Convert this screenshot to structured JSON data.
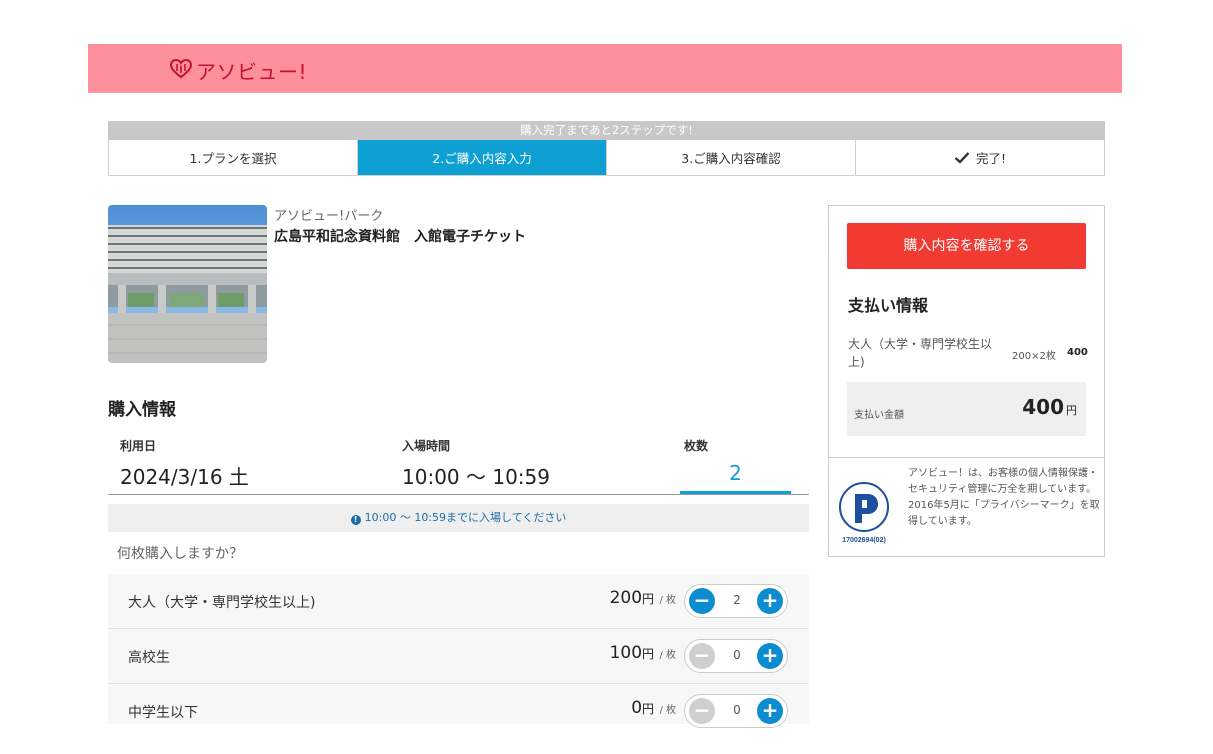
{
  "header": {
    "logo_text": "アソビュー!",
    "brand_color": "#fe909e"
  },
  "steps": {
    "banner": "購入完了まであと2ステップです!",
    "items": [
      {
        "label": "1.プランを選択"
      },
      {
        "label": "2.ご購入内容入力"
      },
      {
        "label": "3.ご購入内容確認"
      },
      {
        "label": "完了!"
      }
    ],
    "active_color": "#0ea0d3"
  },
  "product": {
    "vendor": "アソビュー!パーク",
    "name": "広島平和記念資料館　入館電子チケット"
  },
  "purchase": {
    "title": "購入情報",
    "date_label": "利用日",
    "date_value": "2024/3/16 土",
    "time_label": "入場時間",
    "time_value": "10:00 ～ 10:59",
    "qty_label": "枚数",
    "qty_value": "2",
    "notice_icon": "!",
    "notice": "10:00 ～ 10:59までに入場してください",
    "question": "何枚購入しますか？",
    "tickets": [
      {
        "name": "大人（大学・専門学校生以上)",
        "price": "200",
        "unit": "円",
        "per": "/ 枚",
        "count": "2",
        "minus": "−",
        "plus": "+"
      },
      {
        "name": "高校生",
        "price": "100",
        "unit": "円",
        "per": "/ 枚",
        "count": "0",
        "minus": "−",
        "plus": "+"
      },
      {
        "name": "中学生以下",
        "price": "0",
        "unit": "円",
        "per": "/ 枚",
        "count": "0",
        "minus": "−",
        "plus": "+"
      }
    ]
  },
  "side": {
    "confirm_button": "購入内容を確認する",
    "confirm_color": "#f13b32",
    "payment_title": "支払い情報",
    "payment_item": "大人（大学・専門学校生以上)",
    "payment_detail": "200×2枚",
    "payment_amount": "400",
    "total_label": "支払い金額",
    "total_value": "400",
    "total_unit": "円",
    "privacy_text": "アソビュー！は、お客様の個人情報保護・セキュリティ管理に万全を期しています。2016年5月に「プライバシーマーク」を取得しています。",
    "privacy_mark_number": "17002694(02)"
  }
}
